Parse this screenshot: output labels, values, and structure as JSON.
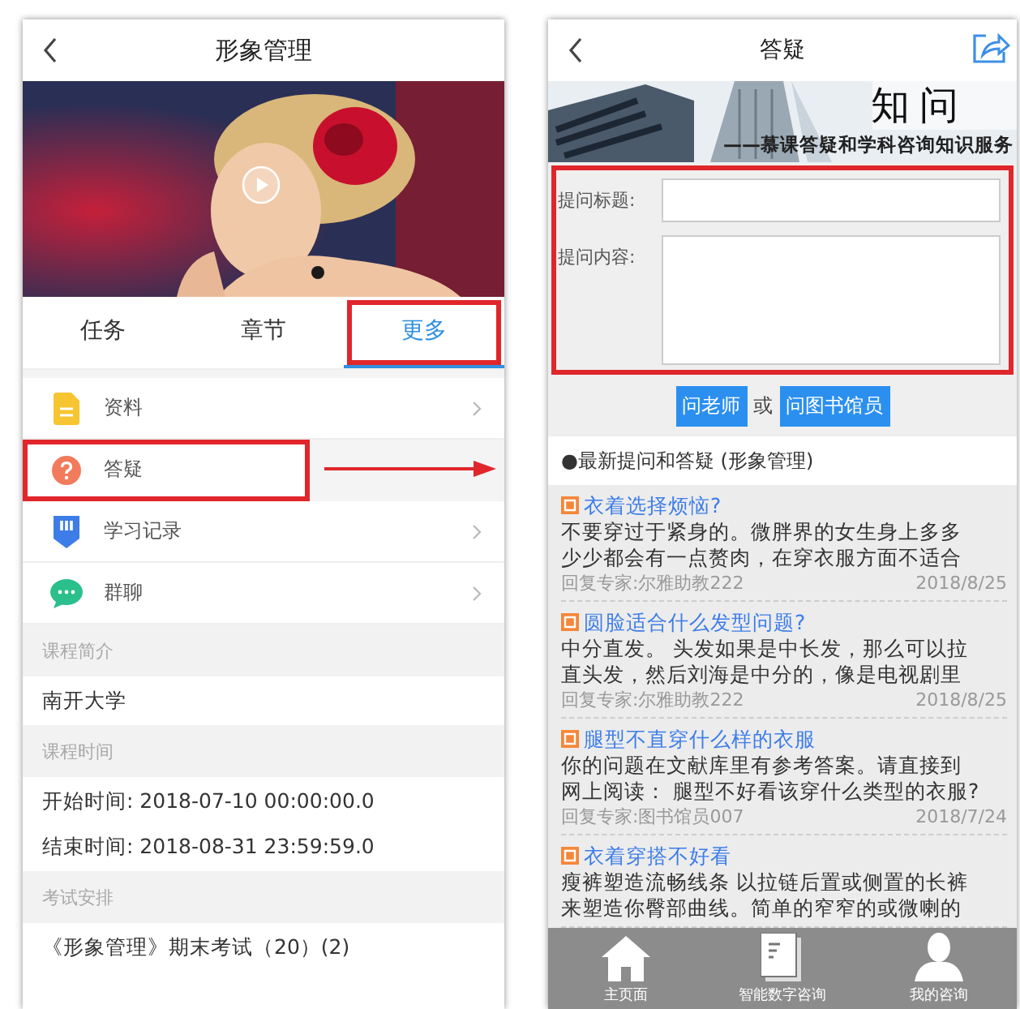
{
  "course_screen": {
    "title": "形象管理",
    "tabs": [
      {
        "label": "任务",
        "selected": false,
        "highlighted": false
      },
      {
        "label": "章节",
        "selected": false,
        "highlighted": false
      },
      {
        "label": "更多",
        "selected": true,
        "highlighted": true
      }
    ],
    "menu": [
      {
        "label": "资料",
        "kind": "document",
        "chevron": true,
        "highlighted": false
      },
      {
        "label": "答疑",
        "kind": "question",
        "chevron": false,
        "highlighted": true
      },
      {
        "label": "学习记录",
        "kind": "record",
        "chevron": true,
        "highlighted": false
      },
      {
        "label": "群聊",
        "kind": "chat",
        "chevron": true,
        "highlighted": false
      }
    ],
    "sections": [
      {
        "heading": "课程简介",
        "lines": [
          "南开大学"
        ]
      },
      {
        "heading": "课程时间",
        "lines": [
          "开始时间: 2018-07-10 00:00:00.0",
          "结束时间: 2018-08-31 23:59:59.0"
        ]
      },
      {
        "heading": "考试安排",
        "lines": [
          "《形象管理》期末考试（20）(2)"
        ]
      }
    ]
  },
  "qa_screen": {
    "title": "答疑",
    "banner": {
      "logo": "知问",
      "tagline": "——慕课答疑和学科咨询知识服务"
    },
    "form": {
      "highlighted": true,
      "fields": [
        {
          "label": "提问标题:",
          "kind": "line"
        },
        {
          "label": "提问内容:",
          "kind": "area"
        }
      ]
    },
    "actions": [
      {
        "label": "问老师",
        "kind": "button"
      },
      {
        "label": "或",
        "kind": "text"
      },
      {
        "label": "问图书馆员",
        "kind": "button"
      }
    ],
    "list_heading": "●最新提问和答疑 (形象管理)",
    "questions": [
      {
        "title": "衣着选择烦恼?",
        "lines": [
          "不要穿过于紧身的。微胖界的女生身上多多",
          "少少都会有一点赘肉，在穿衣服方面不适合"
        ],
        "expert": "回复专家:尔雅助教222",
        "date": "2018/8/25"
      },
      {
        "title": "圆脸适合什么发型问题?",
        "lines": [
          "中分直发。 头发如果是中长发，那么可以拉",
          "直头发，然后刘海是中分的，像是电视剧里"
        ],
        "expert": "回复专家:尔雅助教222",
        "date": "2018/8/25"
      },
      {
        "title": "腿型不直穿什么样的衣服",
        "lines": [
          "你的问题在文献库里有参考答案。请直接到",
          "网上阅读： 腿型不好看该穿什么类型的衣服?"
        ],
        "expert": "回复专家:图书馆员007",
        "date": "2018/7/24"
      },
      {
        "title": "衣着穿搭不好看",
        "lines": [
          "瘦裤塑造流畅线条 以拉链后置或侧置的长裤",
          "来塑造你臀部曲线。简单的窄窄的或微喇的"
        ]
      }
    ],
    "nav": [
      {
        "label": "主页面",
        "kind": "home"
      },
      {
        "label": "智能数字咨询",
        "kind": "book"
      },
      {
        "label": "我的咨询",
        "kind": "person"
      }
    ]
  }
}
